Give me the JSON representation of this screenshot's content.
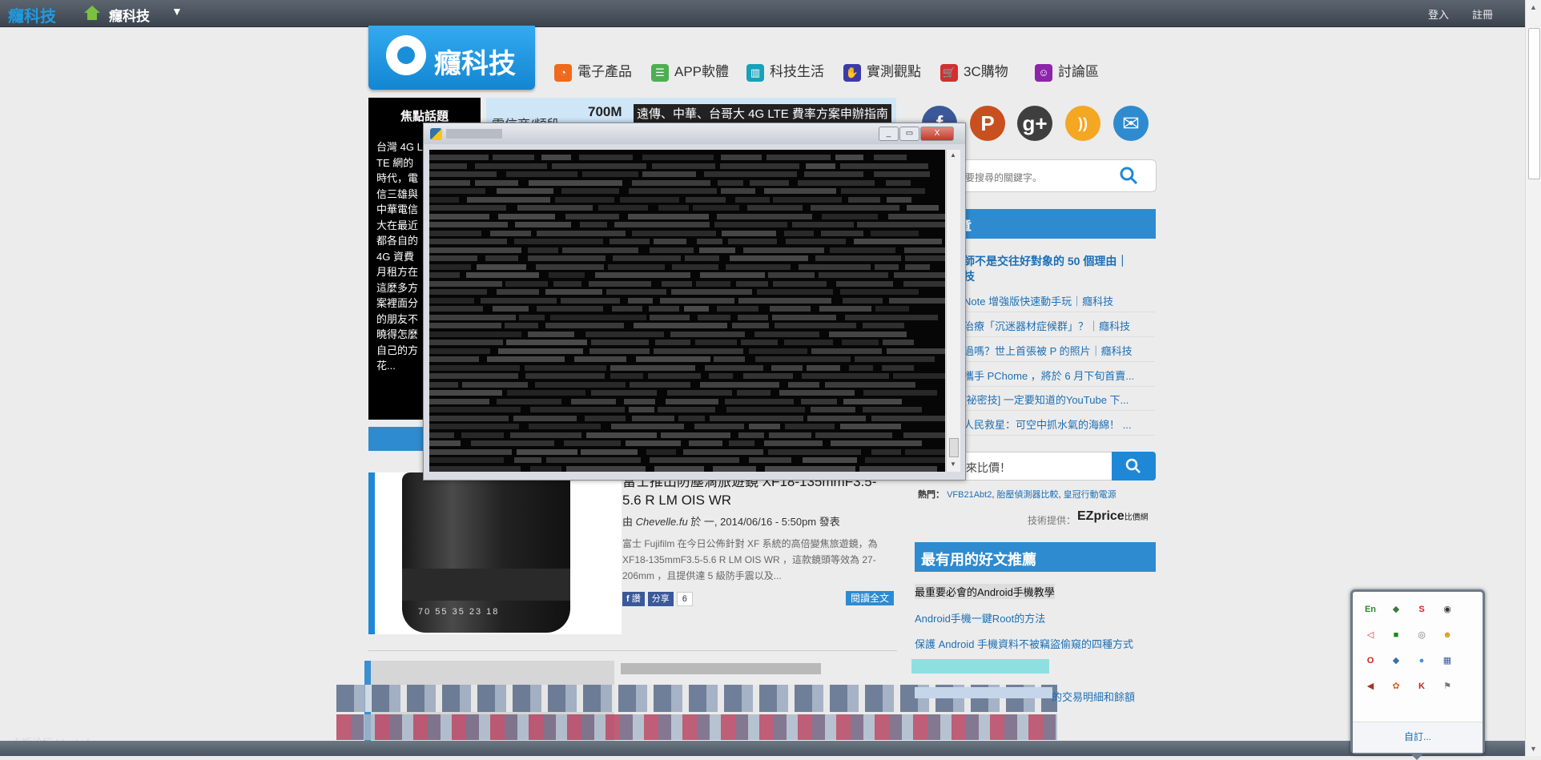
{
  "topbar": {
    "site_name": "癮科技",
    "home_label": "癮科技",
    "dropdown": "▼",
    "login": "登入",
    "register": "註冊"
  },
  "logo": {
    "text": "癮科技"
  },
  "nav": [
    {
      "label": "電子產品",
      "icon": "rss-icon",
      "color": "#f06a1d",
      "glyph": "◔"
    },
    {
      "label": "APP軟體",
      "icon": "chat-icon",
      "color": "#4caf50",
      "glyph": "☰"
    },
    {
      "label": "科技生活",
      "icon": "phone-icon",
      "color": "#16a2b8",
      "glyph": "▥"
    },
    {
      "label": "實測觀點",
      "icon": "hand-icon",
      "color": "#3b3ba8",
      "glyph": "✋"
    },
    {
      "label": "3C購物",
      "icon": "cart-icon",
      "color": "#d32f2f",
      "glyph": "🛒"
    },
    {
      "label": "討論區",
      "icon": "forum-icon",
      "color": "#8e24aa",
      "glyph": "☺"
    }
  ],
  "focus": {
    "heading": "焦點話題",
    "text": "台灣 4G LTE 網的時代，電信三雄與中華電信大在最近都各自的 4G 資費月租方在這麼多方案裡面分的朋友不曉得怎麼自己的方花..."
  },
  "banner": {
    "left_text": "電信商/頻段",
    "bold": "700M",
    "headline": "遠傳、中華、台哥大 4G LTE 費率方案申辦指南"
  },
  "console": {
    "restore": "▭",
    "minimize": "_",
    "close": "X"
  },
  "social": [
    {
      "name": "facebook-icon",
      "glyph": "f",
      "color": "#3b5998"
    },
    {
      "name": "plurk-icon",
      "glyph": "P",
      "color": "#c8501e"
    },
    {
      "name": "google-plus-icon",
      "glyph": "g+",
      "color": "#3f3f3f"
    },
    {
      "name": "rss-feed-icon",
      "glyph": "))",
      "color": "#f5a623"
    },
    {
      "name": "mail-icon",
      "glyph": "✉",
      "color": "#2e8bd0"
    }
  ],
  "search": {
    "placeholder": "要搜尋的關鍵字。"
  },
  "articles_section": {
    "heading": "章",
    "links": [
      "師不是交往好對象的 50 個理由｜",
      "技",
      "Note 增強版快速動手玩｜癮科技",
      "治療「沉迷器材症候群」？｜癮科技",
      "過嗎？世上首張被 P 的照片｜癮科技",
      "攜手 PChome ，將於 6 月下旬首賣...",
      "[祕密技] 一定要知道的YouTube 下...",
      "人民救星：可空中抓水氣的海綿！ ..."
    ]
  },
  "price": {
    "placeholder": "來比價！",
    "hot_label": "熱門：",
    "hot_items": [
      "VFB21Abt2",
      "胎壓偵測器比較",
      "皇冠行動電源"
    ],
    "tech_label": "技術提供：",
    "brand": "EZprice",
    "brand_sub": "比價網"
  },
  "recommended": {
    "heading": "最有用的好文推薦",
    "links": [
      "最重要必會的Android手機教學",
      "Android手機一鍵Root的方法",
      "保護 Android 手機資料不被竊盜偷窺的四種方式",
      "的交易明細和餘額"
    ]
  },
  "article": {
    "title": "富士推出防塵滴旅遊鏡 XF18-135mmF3.5-5.6 R LM OIS WR",
    "meta_by": "由",
    "author": "Chevelle.fu",
    "meta_rest": "於 一, 2014/06/16 - 5:50pm 發表",
    "summary": "富士 Fujifilm 在今日公佈針對 XF 系統的高倍變焦旅遊鏡，為 XF18-135mmF3.5-5.6 R LM OIS WR ，這款鏡頭等效為 27-206mm ，且提供達 5 級防手震以及...",
    "fb_label": "讚",
    "share_label": "分享",
    "share_count": "6",
    "read_more": "閱讀全文",
    "lens_scale": "70 55 35 23 18"
  },
  "watermark": "卡饭论坛 bbs.kafan.cn",
  "tray": {
    "icons": [
      {
        "name": "en-ime-icon",
        "glyph": "En",
        "color": "#2a8a2a"
      },
      {
        "name": "network-icon",
        "glyph": "◆",
        "color": "#3a7a3a"
      },
      {
        "name": "s-app-icon",
        "glyph": "S",
        "color": "#d62020"
      },
      {
        "name": "steam-icon",
        "glyph": "◉",
        "color": "#333333"
      },
      {
        "name": "speaker-muted-icon",
        "glyph": "◁",
        "color": "#cc3333"
      },
      {
        "name": "monitor-icon",
        "glyph": "■",
        "color": "#1d8a1d"
      },
      {
        "name": "search-app-icon",
        "glyph": "◎",
        "color": "#777777"
      },
      {
        "name": "face-app-icon",
        "glyph": "☻",
        "color": "#d4a017"
      },
      {
        "name": "opera-icon",
        "glyph": "O",
        "color": "#d62020"
      },
      {
        "name": "python-icon",
        "glyph": "◆",
        "color": "#3572a5"
      },
      {
        "name": "globe-icon",
        "glyph": "●",
        "color": "#4a90d9"
      },
      {
        "name": "grid-app-icon",
        "glyph": "▦",
        "color": "#3a5aa8"
      },
      {
        "name": "volume-icon",
        "glyph": "◀",
        "color": "#aa3322"
      },
      {
        "name": "gear-app-icon",
        "glyph": "✿",
        "color": "#e06020"
      },
      {
        "name": "k-app-icon",
        "glyph": "K",
        "color": "#cc2222"
      },
      {
        "name": "flag-icon",
        "glyph": "⚑",
        "color": "#777777"
      }
    ],
    "customize": "自訂..."
  }
}
